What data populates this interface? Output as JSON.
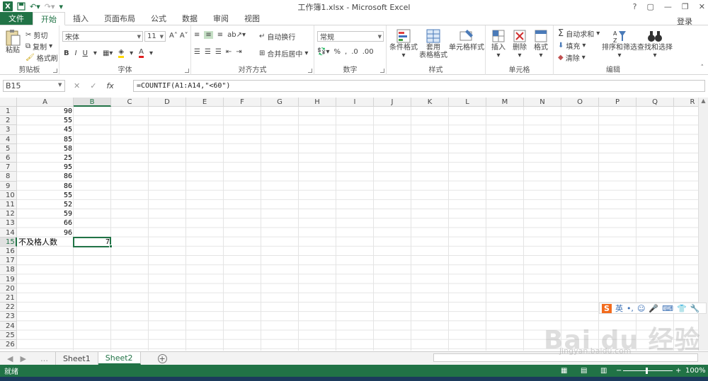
{
  "window": {
    "title": "工作簿1.xlsx - Microsoft Excel",
    "controls": [
      "?",
      "▢",
      "—",
      "❐",
      "✕"
    ],
    "login": "登录"
  },
  "tabs": [
    {
      "label": "文件"
    },
    {
      "label": "开始"
    },
    {
      "label": "插入"
    },
    {
      "label": "页面布局"
    },
    {
      "label": "公式"
    },
    {
      "label": "数据"
    },
    {
      "label": "审阅"
    },
    {
      "label": "视图"
    }
  ],
  "ribbon": {
    "clipboard": {
      "label": "剪贴板",
      "paste": "粘贴",
      "cut": "剪切",
      "copy": "复制",
      "painter": "格式刷"
    },
    "font": {
      "label": "字体",
      "name": "宋体",
      "size": "11",
      "bold": "B",
      "italic": "I",
      "underline": "U"
    },
    "align": {
      "label": "对齐方式",
      "wrap": "自动换行",
      "merge": "合并后居中"
    },
    "number": {
      "label": "数字",
      "format": "常规",
      "percent": "%",
      "comma": ","
    },
    "styles": {
      "label": "样式",
      "cond": "条件格式",
      "table1": "套用",
      "table2": "表格格式",
      "cellstyle": "单元格样式"
    },
    "cells": {
      "label": "单元格",
      "insert": "插入",
      "delete": "删除",
      "format": "格式"
    },
    "edit": {
      "label": "编辑",
      "autosum": "自动求和",
      "fill": "填充",
      "clear": "清除",
      "sort": "排序和筛选",
      "find": "查找和选择"
    }
  },
  "formula_bar": {
    "name_box": "B15",
    "fx": "fx",
    "formula": "=COUNTIF(A1:A14,\"<60\")"
  },
  "columns": [
    "A",
    "B",
    "C",
    "D",
    "E",
    "F",
    "G",
    "H",
    "I",
    "J",
    "K",
    "L",
    "M",
    "N",
    "O",
    "P",
    "Q",
    "R"
  ],
  "rows": [
    "1",
    "2",
    "3",
    "4",
    "5",
    "6",
    "7",
    "8",
    "9",
    "10",
    "11",
    "12",
    "13",
    "14",
    "15",
    "16",
    "17",
    "18",
    "19",
    "20",
    "21",
    "22",
    "23",
    "24",
    "25",
    "26"
  ],
  "cells": {
    "A": [
      "90",
      "55",
      "45",
      "85",
      "58",
      "25",
      "95",
      "86",
      "86",
      "55",
      "52",
      "59",
      "66",
      "96"
    ],
    "A15": "不及格人数",
    "B15": "7"
  },
  "sheets": [
    {
      "label": "Sheet1"
    },
    {
      "label": "Sheet2"
    }
  ],
  "status": {
    "ready": "就绪",
    "zoom": "100%"
  },
  "ime": {
    "lang": "英"
  },
  "watermark": {
    "main": "Bai du 经验",
    "sub": "jingyan.baidu.com"
  }
}
